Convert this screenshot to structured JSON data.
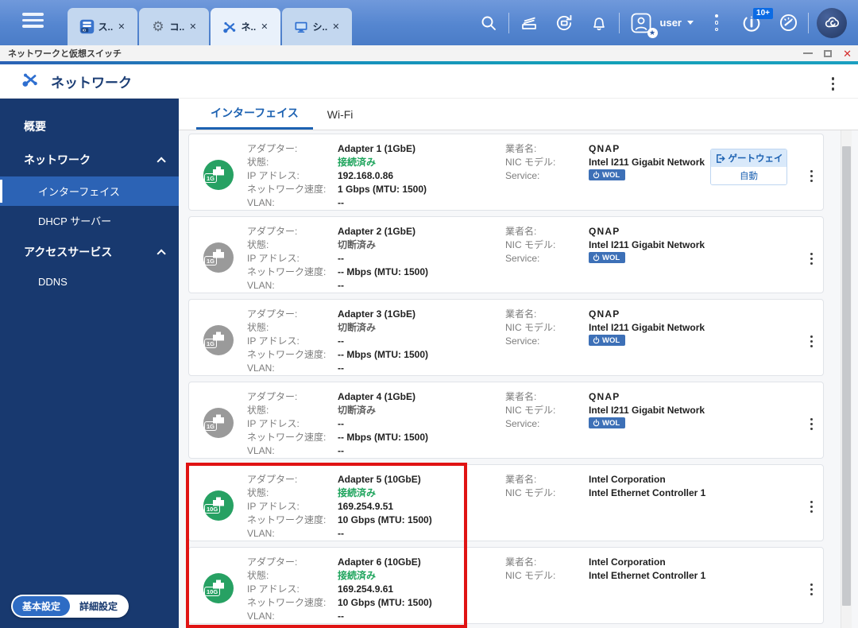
{
  "topbar": {
    "tabs": [
      {
        "label": "ス..",
        "icon": "storage-app-icon",
        "active": false
      },
      {
        "label": "コ..",
        "icon": "control-panel-app-icon",
        "active": false
      },
      {
        "label": "ネ..",
        "icon": "network-app-icon",
        "active": true
      },
      {
        "label": "シ..",
        "icon": "system-app-icon",
        "active": false
      }
    ],
    "user_label": "user",
    "info_badge": "10+",
    "icons": [
      "hamburger-icon",
      "search-icon",
      "background-tasks-icon",
      "sync-icon",
      "notifications-bell-icon",
      "user-avatar-icon",
      "more-options-kebab-icon",
      "update-info-icon",
      "dashboard-gauge-icon",
      "myqnapcloud-icon"
    ]
  },
  "window": {
    "title": "ネットワークと仮想スイッチ",
    "controls": [
      "minimize-icon",
      "maximize-icon",
      "close-icon"
    ]
  },
  "app_header": {
    "title": "ネットワーク",
    "icon": "network-app-icon"
  },
  "sidebar": {
    "items": [
      {
        "label": "概要"
      },
      {
        "label": "ネットワーク"
      },
      {
        "label": "インターフェイス"
      },
      {
        "label": "DHCP サーバー"
      },
      {
        "label": "アクセスサービス"
      },
      {
        "label": "DDNS"
      }
    ],
    "mode_toggle": {
      "basic": "基本設定",
      "advanced": "詳細設定",
      "selected": "basic"
    }
  },
  "content": {
    "tabs": [
      {
        "label": "インターフェイス",
        "active": true
      },
      {
        "label": "Wi-Fi",
        "active": false
      }
    ],
    "row_labels": {
      "adapter": "アダプター:",
      "status": "状態:",
      "ip": "IP アドレス:",
      "speed": "ネットワーク速度:",
      "vlan": "VLAN:",
      "vendor": "業者名:",
      "nic": "NIC モデル:",
      "service": "Service:"
    },
    "wol_label": "WOL",
    "adapters": [
      {
        "icon": "1G",
        "icon_color": "#27a163",
        "name": "Adapter 1 (1GbE)",
        "status": "接続済み",
        "connected": true,
        "ip": "192.168.0.86",
        "speed": "1 Gbps (MTU: 1500)",
        "vlan": "--",
        "vendor": "QNAP",
        "vendor_logo": true,
        "nic": "Intel I211 Gigabit Network",
        "wol": true,
        "service_row": true,
        "gateway": {
          "label": "ゲートウェイ",
          "value": "自動"
        }
      },
      {
        "icon": "1G",
        "icon_color": "#9a9a9a",
        "name": "Adapter 2 (1GbE)",
        "status": "切断済み",
        "connected": false,
        "ip": "--",
        "speed": "-- Mbps (MTU: 1500)",
        "vlan": "--",
        "vendor": "QNAP",
        "vendor_logo": true,
        "nic": "Intel I211 Gigabit Network",
        "wol": true,
        "service_row": true
      },
      {
        "icon": "1G",
        "icon_color": "#9a9a9a",
        "name": "Adapter 3 (1GbE)",
        "status": "切断済み",
        "connected": false,
        "ip": "--",
        "speed": "-- Mbps (MTU: 1500)",
        "vlan": "--",
        "vendor": "QNAP",
        "vendor_logo": true,
        "nic": "Intel I211 Gigabit Network",
        "wol": true,
        "service_row": true
      },
      {
        "icon": "1G",
        "icon_color": "#9a9a9a",
        "name": "Adapter 4 (1GbE)",
        "status": "切断済み",
        "connected": false,
        "ip": "--",
        "speed": "-- Mbps (MTU: 1500)",
        "vlan": "--",
        "vendor": "QNAP",
        "vendor_logo": true,
        "nic": "Intel I211 Gigabit Network",
        "wol": true,
        "service_row": true
      },
      {
        "icon": "10G",
        "icon_color": "#27a163",
        "name": "Adapter 5 (10GbE)",
        "status": "接続済み",
        "connected": true,
        "ip": "169.254.9.51",
        "speed": "10 Gbps (MTU: 1500)",
        "vlan": "--",
        "vendor": "Intel Corporation",
        "vendor_logo": false,
        "nic": "Intel Ethernet Controller 1",
        "wol": false,
        "service_row": false
      },
      {
        "icon": "10G",
        "icon_color": "#27a163",
        "name": "Adapter 6 (10GbE)",
        "status": "接続済み",
        "connected": true,
        "ip": "169.254.9.61",
        "speed": "10 Gbps (MTU: 1500)",
        "vlan": "--",
        "vendor": "Intel Corporation",
        "vendor_logo": false,
        "nic": "Intel Ethernet Controller 1",
        "wol": false,
        "service_row": false
      }
    ],
    "highlight": {
      "rows": [
        5,
        6
      ],
      "color": "#e01313"
    }
  }
}
